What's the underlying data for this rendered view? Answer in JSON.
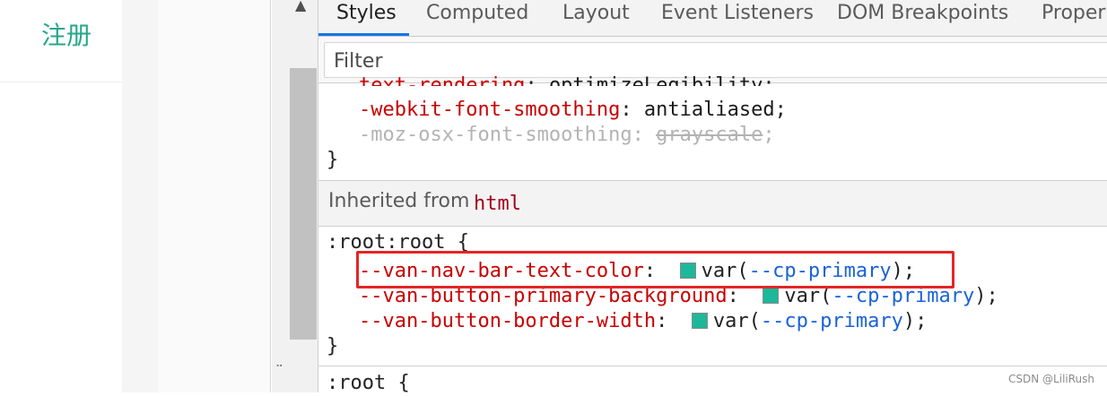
{
  "app": {
    "title": "注册",
    "accent": "#26a78b"
  },
  "devtools": {
    "tabs": [
      {
        "label": "Styles",
        "active": true
      },
      {
        "label": "Computed",
        "active": false
      },
      {
        "label": "Layout",
        "active": false
      },
      {
        "label": "Event Listeners",
        "active": false
      },
      {
        "label": "DOM Breakpoints",
        "active": false
      },
      {
        "label": "Proper",
        "active": false
      }
    ],
    "filter": {
      "placeholder": "Filter"
    },
    "top_rule": {
      "line1_prop": "text-rendering",
      "line1_val": "optimizeLegibility",
      "line2_prop": "-webkit-font-smoothing",
      "line2_val": "antialiased",
      "line3_prop": "-moz-osx-font-smoothing",
      "line3_val": "grayscale",
      "close": "}"
    },
    "inherited": {
      "label": "Inherited from",
      "tag": "html"
    },
    "root_rule": {
      "selector": ":root:root {",
      "decls": [
        {
          "prop": "--van-nav-bar-text-color",
          "var": "--cp-primary"
        },
        {
          "prop": "--van-button-primary-background",
          "var": "--cp-primary"
        },
        {
          "prop": "--van-button-border-width",
          "var": "--cp-primary"
        }
      ],
      "close": "}"
    },
    "next_rule": {
      "selector": ":root {"
    },
    "swatch_color": "#1db89a"
  },
  "watermark": "CSDN @LiliRush"
}
